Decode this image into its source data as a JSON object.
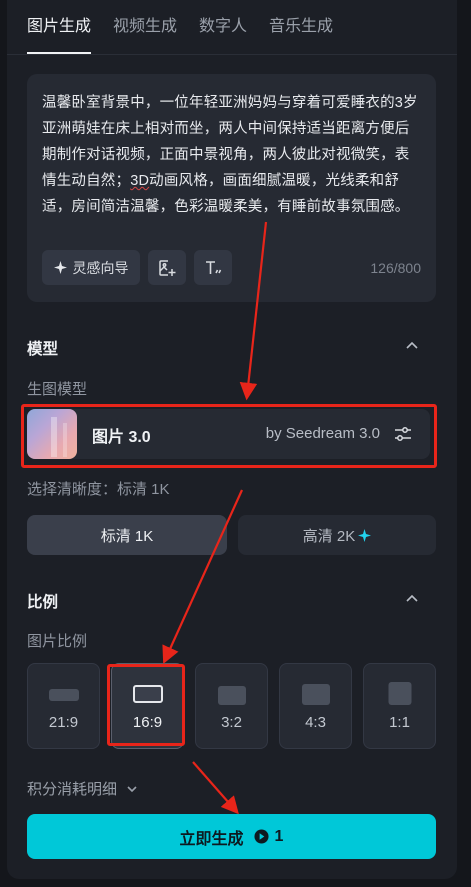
{
  "tabs": [
    {
      "label": "图片生成",
      "active": true
    },
    {
      "label": "视频生成",
      "active": false
    },
    {
      "label": "数字人",
      "active": false
    },
    {
      "label": "音乐生成",
      "active": false
    }
  ],
  "prompt": {
    "text_before": "温馨卧室背景中，一位年轻亚洲妈妈与穿着可爱睡衣的3岁亚洲萌娃在床上相对而坐，两人中间保持适当距离方便后期制作对话视频，正面中景视角，两人彼此对视微笑，表情生动自然；",
    "text_underlined": "3D",
    "text_after": "动画风格，画面细腻温暖，光线柔和舒适，房间简洁温馨，色彩温暖柔美，有睡前故事氛围感。",
    "inspiration_label": "灵感向导",
    "counter": "126/800"
  },
  "model_section": {
    "title": "模型",
    "sub_label": "生图模型",
    "model_name": "图片 3.0",
    "model_by": "by Seedream 3.0",
    "resolution_label": "选择清晰度：标清 1K",
    "resolution_options": [
      {
        "label": "标清 1K",
        "selected": true
      },
      {
        "label": "高清 2K",
        "selected": false
      }
    ]
  },
  "ratio_section": {
    "title": "比例",
    "sub_label": "图片比例",
    "ratios": [
      {
        "label": "21:9",
        "selected": false
      },
      {
        "label": "16:9",
        "selected": true
      },
      {
        "label": "3:2",
        "selected": false
      },
      {
        "label": "4:3",
        "selected": false
      },
      {
        "label": "1:1",
        "selected": false
      }
    ]
  },
  "credits_label": "积分消耗明细",
  "generate": {
    "label": "立即生成",
    "cost": "1"
  },
  "colors": {
    "accent": "#00c8d8",
    "annotation": "#e8251a",
    "panel": "#1c1f26"
  }
}
